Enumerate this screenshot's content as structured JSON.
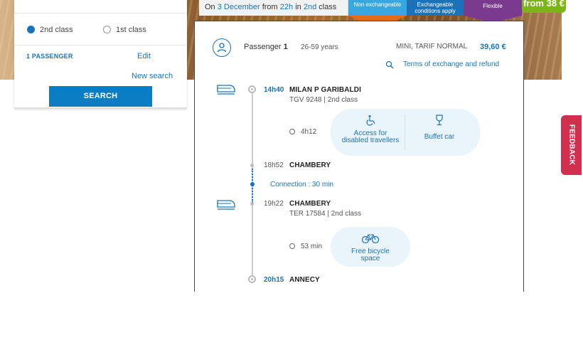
{
  "search": {
    "class_2": "2nd class",
    "class_1": "1st class",
    "passengers": "1 PASSENGER",
    "edit": "Edit",
    "new_search": "New search",
    "search_button": "SEARCH"
  },
  "header": {
    "date_prefix": "On ",
    "date": "3 December",
    "from": " from ",
    "hour": "22h",
    "in": " in ",
    "class_label": "2nd",
    "class_suffix": " class",
    "tab_non_exchangeable": "Non exchangeable",
    "tab_exchangeable": "Exchangeable conditions apply",
    "tab_flexible": "Flexible",
    "price_tab": "from 38 €"
  },
  "passenger": {
    "label": "Passenger",
    "number": "1",
    "age": "26-59 years",
    "fare": "MINI, TARIF NORMAL",
    "price": "39,60 €",
    "terms": "Terms of exchange and refund"
  },
  "journey": {
    "leg1": {
      "dep_time": "14h40",
      "dep_station": "MILAN P GARIBALDI",
      "train": "TGV 9248 | 2nd class",
      "duration": "4h12",
      "services": [
        "Access for disabled travellers",
        "Buffet car"
      ],
      "arr_time": "18h52",
      "arr_station": "CHAMBERY"
    },
    "connection": "Connection : 30 min",
    "leg2": {
      "dep_time": "19h22",
      "dep_station": "CHAMBERY",
      "train": "TER 17584 | 2nd class",
      "duration": "53 min",
      "services": [
        "Free bicycle space"
      ],
      "arr_time": "20h15",
      "arr_station": "ANNECY"
    }
  },
  "feedback": "FEEDBACK",
  "colors": {
    "accent": "#1a73b9",
    "search_button": "#0b7dc4",
    "non_exchangeable": "#37a7e2",
    "non_exchangeable_arrow": "#e36b18",
    "exchangeable": "#1a73b9",
    "flexible": "#7a3a8e",
    "price_tab": "#7cb518",
    "feedback": "#d0304d"
  }
}
